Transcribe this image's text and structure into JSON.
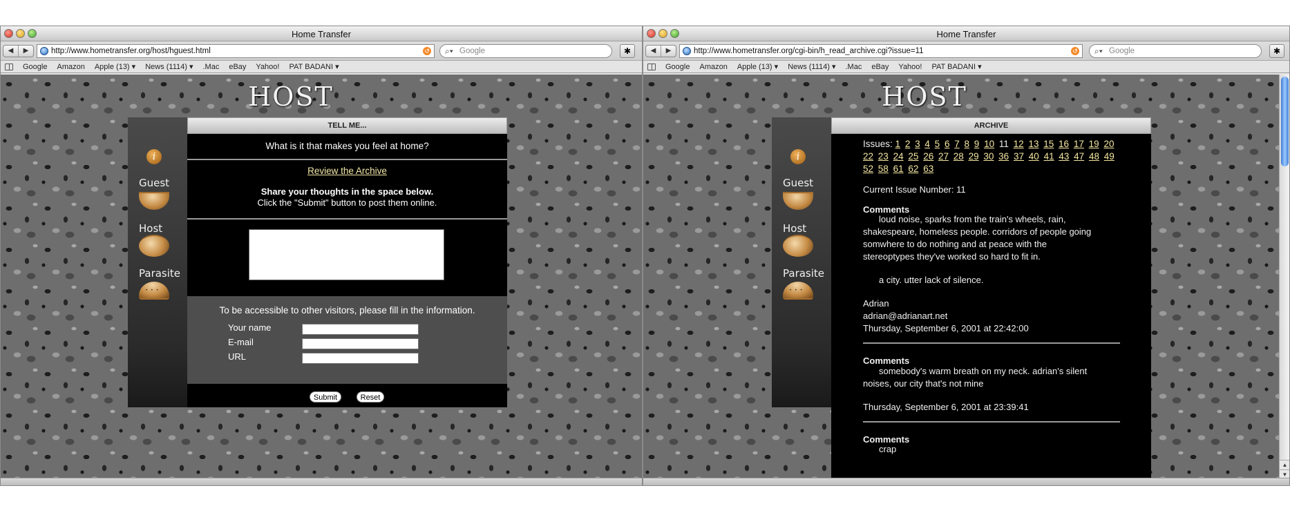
{
  "left": {
    "window_title": "Home Transfer",
    "url": "http://www.hometransfer.org/host/hguest.html",
    "search_placeholder": "Google",
    "bookmarks": [
      "Google",
      "Amazon",
      "Apple (13) ▾",
      "News (1114) ▾",
      ".Mac",
      "eBay",
      "Yahoo!",
      "PAT BADANI ▾"
    ],
    "logo": "HOST",
    "sidebar": {
      "guest": "Guest",
      "host": "Host",
      "parasite": "Parasite"
    },
    "header": "TELL ME...",
    "question": "What is it that makes you feel at home?",
    "archive_link": "Review the Archive",
    "share_line1": "Share your thoughts in the space below.",
    "share_line2": "Click the \"Submit\" button to post them online.",
    "info_title": "To be accessible to other visitors, please fill in the information.",
    "fields": {
      "name": "Your name",
      "email": "E-mail",
      "url": "URL"
    },
    "buttons": {
      "submit": "Submit",
      "reset": "Reset"
    }
  },
  "right": {
    "window_title": "Home Transfer",
    "url": "http://www.hometransfer.org/cgi-bin/h_read_archive.cgi?issue=11",
    "search_placeholder": "Google",
    "bookmarks": [
      "Google",
      "Amazon",
      "Apple (13) ▾",
      "News (1114) ▾",
      ".Mac",
      "eBay",
      "Yahoo!",
      "PAT BADANI ▾"
    ],
    "logo": "HOST",
    "sidebar": {
      "guest": "Guest",
      "host": "Host",
      "parasite": "Parasite"
    },
    "header": "ARCHIVE",
    "issues_label": "Issues:",
    "issues_before": [
      "1",
      "2",
      "3",
      "4",
      "5",
      "6",
      "7",
      "8",
      "9",
      "10"
    ],
    "issue_current": "11",
    "issues_after": [
      "12",
      "13",
      "15",
      "16",
      "17",
      "19",
      "20",
      "22",
      "23",
      "24",
      "25",
      "26",
      "27",
      "28",
      "29",
      "30",
      "36",
      "37",
      "40",
      "41",
      "43",
      "47",
      "48",
      "49",
      "52",
      "58",
      "61",
      "62",
      "63"
    ],
    "current_issue": "Current Issue Number: 11",
    "comments_label": "Comments",
    "entry1": {
      "text1": "loud noise, sparks from the train's wheels, rain,",
      "text2": "shakespeare, homeless people. corridors of people going",
      "text3": "somwhere to do nothing and at peace with the",
      "text4": "stereoptypes they've worked so hard to fit in.",
      "text5": "a city. utter lack of silence.",
      "name": "Adrian",
      "email": "adrian@adrianart.net",
      "date": "Thursday, September 6, 2001 at 22:42:00"
    },
    "entry2": {
      "text1": "somebody's warm breath on my neck. adrian's silent",
      "text2": "noises, our city that's not mine",
      "date": "Thursday, September 6, 2001 at 23:39:41"
    },
    "entry3": {
      "text1": "crap"
    }
  },
  "colors": {
    "link": "#f4e7a0",
    "panel": "#000000",
    "infobox": "#4e4e4e"
  }
}
